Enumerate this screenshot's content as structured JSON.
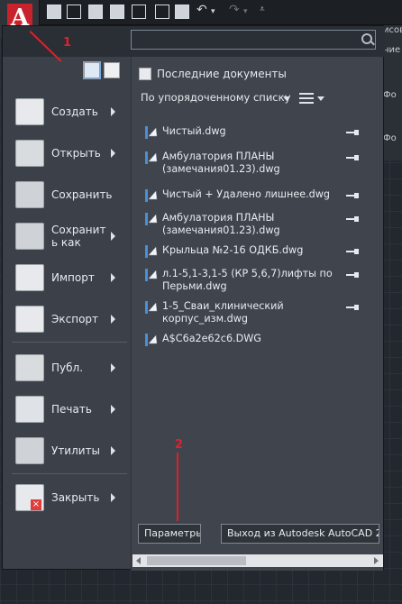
{
  "right_strip": {
    "texts": [
      "исов",
      "ние",
      "Фо",
      "Фо"
    ]
  },
  "search": {
    "placeholder": "",
    "value": ""
  },
  "recent": {
    "title": "Последние документы",
    "order_label": "По упорядоченному списку",
    "documents": [
      {
        "name": "Чистый.dwg"
      },
      {
        "name": "Амбулатория ПЛАНЫ (замечания01.23).dwg"
      },
      {
        "name": "Чистый + Удалено лишнее.dwg"
      },
      {
        "name": "Амбулатория ПЛАНЫ (замечания01.23).dwg"
      },
      {
        "name": "Крыльца  №2-16 ОДКБ.dwg"
      },
      {
        "name": "л.1-5,1-3,1-5 (КР 5,6,7)лифты по Перьми.dwg"
      },
      {
        "name": "1-5_Сваи_клинический корпус_изм.dwg"
      },
      {
        "name": "A$C6a2e62c6.DWG"
      }
    ]
  },
  "commands": [
    {
      "label": "Создать",
      "icon": "new-document-icon",
      "submenu": true
    },
    {
      "label": "Открыть",
      "icon": "open-folder-icon",
      "submenu": true
    },
    {
      "label": "Сохранить",
      "icon": "save-icon",
      "submenu": false
    },
    {
      "label": "Сохранит ь как",
      "icon": "save-as-icon",
      "submenu": true
    },
    {
      "label": "Импорт",
      "icon": "import-icon",
      "submenu": true
    },
    {
      "label": "Экспорт",
      "icon": "export-icon",
      "submenu": true
    },
    {
      "label": "Публ.",
      "icon": "publish-icon",
      "submenu": true
    },
    {
      "label": "Печать",
      "icon": "print-icon",
      "submenu": true
    },
    {
      "label": "Утилиты",
      "icon": "utilities-wrench-icon",
      "submenu": true
    },
    {
      "label": "Закрыть",
      "icon": "close-document-icon",
      "submenu": true
    }
  ],
  "buttons": {
    "options": "Параметры",
    "exit": "Выход из Autodesk AutoCAD 2021"
  },
  "annotations": {
    "one": "1",
    "two": "2"
  },
  "colors": {
    "accent_red": "#c8232c",
    "annotation_red": "#e2202a",
    "panel": "#3b4049"
  }
}
